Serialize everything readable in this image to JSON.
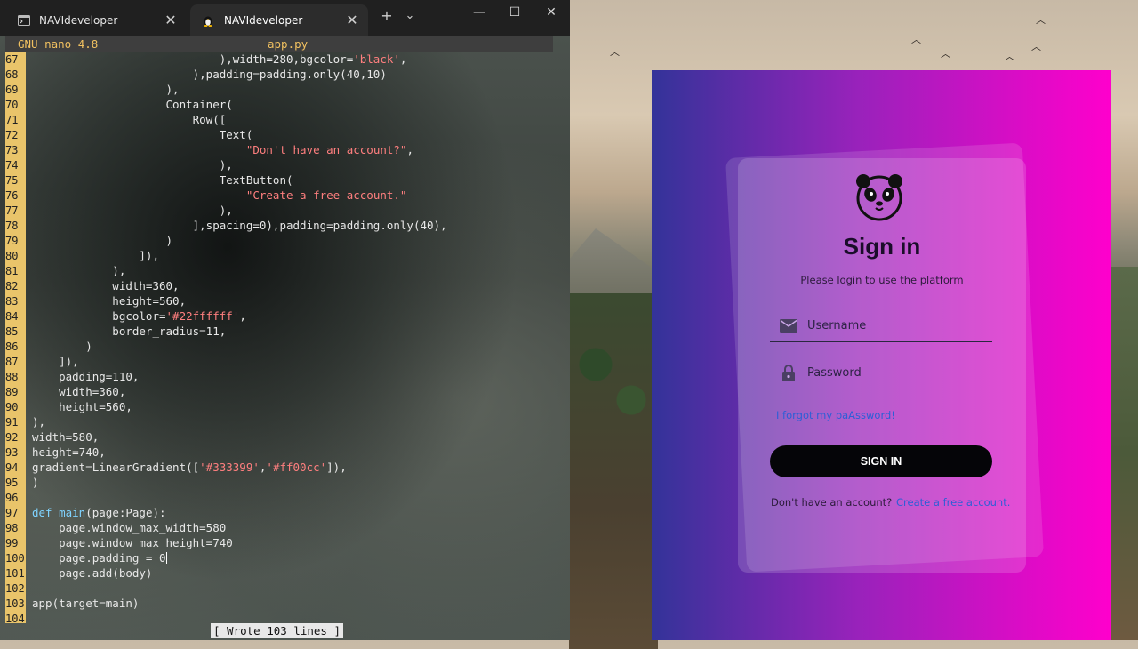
{
  "terminal": {
    "tabs": [
      {
        "label": "NAVIdeveloper",
        "icon": "console-icon",
        "active": false
      },
      {
        "label": "NAVIdeveloper",
        "icon": "linux-penguin-icon",
        "active": true
      }
    ],
    "new_tab_glyph": "+",
    "dropdown_glyph": "⌄",
    "window_controls": {
      "minimize": "—",
      "maximize": "☐",
      "close": "✕"
    },
    "nano": {
      "version": "GNU nano 4.8",
      "filename": "app.py",
      "status": "[ Wrote 103 lines ]"
    },
    "code_lines": [
      {
        "n": "67",
        "text": "                            ),width=280,bgcolor='black',"
      },
      {
        "n": "68",
        "text": "                        ),padding=padding.only(40,10)"
      },
      {
        "n": "69",
        "text": "                    ),"
      },
      {
        "n": "70",
        "text": "                    Container("
      },
      {
        "n": "71",
        "text": "                        Row(["
      },
      {
        "n": "72",
        "text": "                            Text("
      },
      {
        "n": "73",
        "text": "                                \"Don't have an account?\","
      },
      {
        "n": "74",
        "text": "                            ),"
      },
      {
        "n": "75",
        "text": "                            TextButton("
      },
      {
        "n": "76",
        "text": "                                \"Create a free account.\""
      },
      {
        "n": "77",
        "text": "                            ),"
      },
      {
        "n": "78",
        "text": "                        ],spacing=0),padding=padding.only(40),"
      },
      {
        "n": "79",
        "text": "                    )"
      },
      {
        "n": "80",
        "text": "                ]),"
      },
      {
        "n": "81",
        "text": "            ),"
      },
      {
        "n": "82",
        "text": "            width=360,"
      },
      {
        "n": "83",
        "text": "            height=560,"
      },
      {
        "n": "84",
        "text": "            bgcolor='#22ffffff',"
      },
      {
        "n": "85",
        "text": "            border_radius=11,"
      },
      {
        "n": "86",
        "text": "        )"
      },
      {
        "n": "87",
        "text": "    ]),"
      },
      {
        "n": "88",
        "text": "    padding=110,"
      },
      {
        "n": "89",
        "text": "    width=360,"
      },
      {
        "n": "90",
        "text": "    height=560,"
      },
      {
        "n": "91",
        "text": "),"
      },
      {
        "n": "92",
        "text": "width=580,"
      },
      {
        "n": "93",
        "text": "height=740,"
      },
      {
        "n": "94",
        "text": "gradient=LinearGradient(['#333399','#ff00cc']),"
      },
      {
        "n": "95",
        "text": ")"
      },
      {
        "n": "96",
        "text": ""
      },
      {
        "n": "97",
        "text": "def main(page:Page):"
      },
      {
        "n": "98",
        "text": "    page.window_max_width=580"
      },
      {
        "n": "99",
        "text": "    page.window_max_height=740"
      },
      {
        "n": "100",
        "text": "    page.padding = 0"
      },
      {
        "n": "101",
        "text": "    page.add(body)"
      },
      {
        "n": "102",
        "text": ""
      },
      {
        "n": "103",
        "text": "app(target=main)"
      },
      {
        "n": "104",
        "text": ""
      }
    ]
  },
  "login_app": {
    "logo": "panda-icon",
    "title": "Sign in",
    "subtitle": "Please login to use the platform",
    "username_placeholder": "Username",
    "password_placeholder": "Password",
    "forgot_link": "I forgot my paAssword!",
    "signin_button": "SIGN IN",
    "no_account_text": "Don't have an account?",
    "create_account_link": "Create a free account.",
    "colors": {
      "gradient_start": "#333399",
      "gradient_end": "#ff00cc",
      "button": "#050508",
      "link": "#2c5fd6"
    }
  }
}
